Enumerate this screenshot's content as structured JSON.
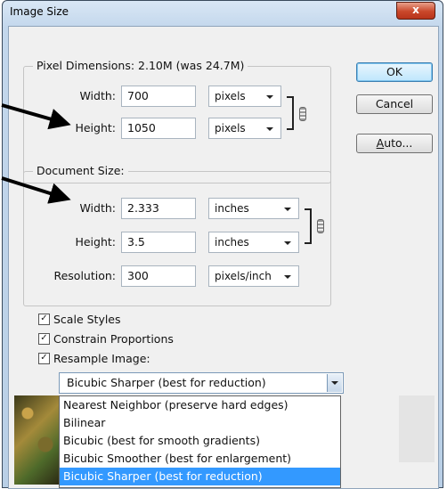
{
  "window": {
    "title": "Image Size",
    "close": "x"
  },
  "pixel_dimensions": {
    "label": "Pixel Dimensions:  2.10M (was 24.7M)",
    "width": {
      "label": "Width:",
      "value": "700",
      "unit": "pixels"
    },
    "height": {
      "label": "Height:",
      "value": "1050",
      "unit": "pixels"
    }
  },
  "document_size": {
    "label": "Document Size:",
    "width": {
      "label": "Width:",
      "value": "2.333",
      "unit": "inches"
    },
    "height": {
      "label": "Height:",
      "value": "3.5",
      "unit": "inches"
    },
    "resolution": {
      "label": "Resolution:",
      "value": "300",
      "unit": "pixels/inch"
    }
  },
  "buttons": {
    "ok": "OK",
    "cancel": "Cancel",
    "auto": "Auto..."
  },
  "options": {
    "scale_styles": {
      "label": "Scale Styles",
      "checked": true
    },
    "constrain": {
      "label": "Constrain Proportions",
      "checked": true
    },
    "resample": {
      "label": "Resample Image:",
      "checked": true
    }
  },
  "resample_method": {
    "selected": "Bicubic Sharper (best for reduction)",
    "options": [
      "Nearest Neighbor (preserve hard edges)",
      "Bilinear",
      "Bicubic (best for smooth gradients)",
      "Bicubic Smoother (best for enlargement)",
      "Bicubic Sharper (best for reduction)"
    ]
  },
  "icons": {
    "chain": "chain-link-icon",
    "dropdown": "chevron-down-icon",
    "arrow": "pointer-arrow-icon"
  }
}
